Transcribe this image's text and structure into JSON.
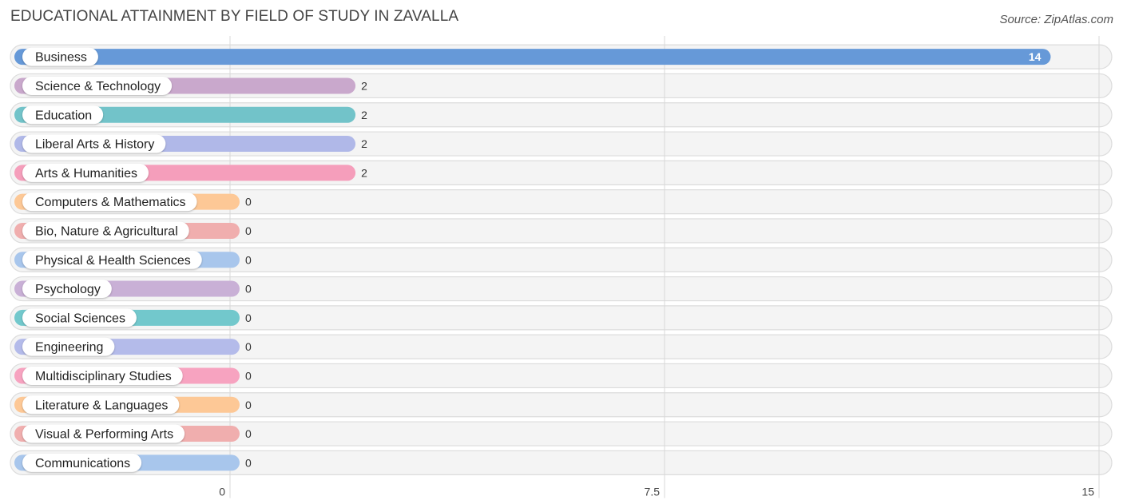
{
  "title": "EDUCATIONAL ATTAINMENT BY FIELD OF STUDY IN ZAVALLA",
  "source": "Source: ZipAtlas.com",
  "chart_data": {
    "type": "bar",
    "orientation": "horizontal",
    "title": "EDUCATIONAL ATTAINMENT BY FIELD OF STUDY IN ZAVALLA",
    "xlabel": "",
    "ylabel": "",
    "xlim": [
      0,
      15
    ],
    "xticks": [
      0,
      7.5,
      15
    ],
    "xtick_labels": [
      "0",
      "7.5",
      "15"
    ],
    "grid": true,
    "categories": [
      "Business",
      "Science & Technology",
      "Education",
      "Liberal Arts & History",
      "Arts & Humanities",
      "Computers & Mathematics",
      "Bio, Nature & Agricultural",
      "Physical & Health Sciences",
      "Psychology",
      "Social Sciences",
      "Engineering",
      "Multidisciplinary Studies",
      "Literature & Languages",
      "Visual & Performing Arts",
      "Communications"
    ],
    "values": [
      14,
      2,
      2,
      2,
      2,
      0,
      0,
      0,
      0,
      0,
      0,
      0,
      0,
      0,
      0
    ],
    "colors": [
      "#6699d8",
      "#c9a8cc",
      "#72c3c9",
      "#b0b8e8",
      "#f59ebb",
      "#fdc896",
      "#f0aeae",
      "#a8c6ec",
      "#c9b0d6",
      "#72c8cc",
      "#b4bbea",
      "#f7a3c0",
      "#fdc896",
      "#f0aeae",
      "#a8c6ec"
    ]
  }
}
